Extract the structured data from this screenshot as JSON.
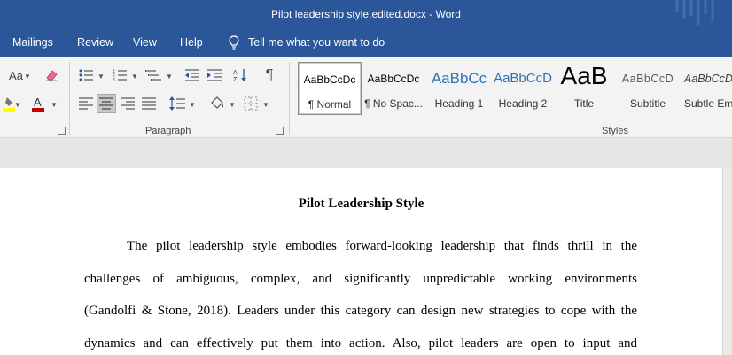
{
  "window": {
    "title": "Pilot leadership style.edited.docx  -  Word"
  },
  "tabs": [
    "Mailings",
    "Review",
    "View",
    "Help"
  ],
  "tell_me": {
    "placeholder": "Tell me what you want to do",
    "icon": "lightbulb-icon"
  },
  "ribbon": {
    "groups": {
      "paragraph": "Paragraph",
      "styles": "Styles"
    },
    "font_controls": {
      "font_size_label": "Aa"
    },
    "styles": [
      {
        "sample": "AaBbCcDc",
        "name": "¶ Normal",
        "color": "#000000",
        "selected": true
      },
      {
        "sample": "AaBbCcDc",
        "name": "¶ No Spac...",
        "color": "#000000"
      },
      {
        "sample": "AaBbCc",
        "name": "Heading 1",
        "color": "#2e74b5"
      },
      {
        "sample": "AaBbCcD",
        "name": "Heading 2",
        "color": "#2e74b5"
      },
      {
        "sample": "AaB",
        "name": "Title",
        "color": "#000000"
      },
      {
        "sample": "AaBbCcD",
        "name": "Subtitle",
        "color": "#595959"
      },
      {
        "sample": "AaBbCcD",
        "name": "Subtle Em...",
        "color": "#404040"
      }
    ]
  },
  "document": {
    "title": "Pilot Leadership Style",
    "lines": [
      "The pilot leadership style embodies forward-looking leadership that finds thrill in the",
      "challenges of ambiguous, complex, and significantly unpredictable working environments",
      "(Gandolfi & Stone, 2018). Leaders under this category can design new strategies to cope with the",
      "dynamics and can effectively put them into action. Also, pilot leaders are open to input and"
    ]
  },
  "colors": {
    "accent": "#2b579a",
    "ribbon_bg": "#f3f3f3",
    "highlight": "#ffff00",
    "font_color": "#c00000"
  }
}
